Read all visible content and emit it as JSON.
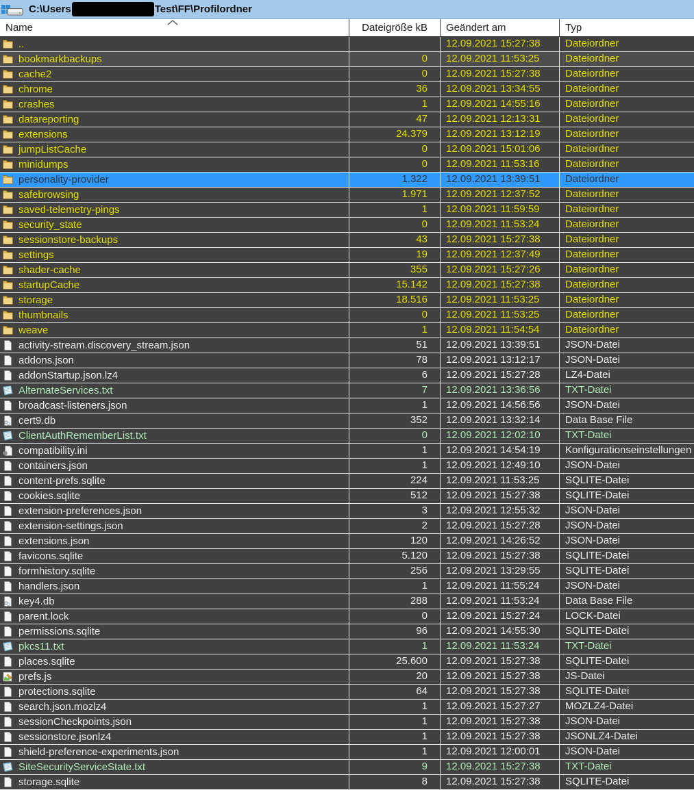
{
  "window": {
    "title_prefix": "C:\\Users",
    "title_suffix": "Test\\FF\\Profilordner",
    "username_redacted": true
  },
  "colors": {
    "titlebar_bg": "#A5C9E9",
    "row_bg": "#414141",
    "cursor_row_bg": "#4D4D4D",
    "selected_bg": "#2F99FC",
    "folder_text": "#E2DF00",
    "file_text": "#EDEDED",
    "txt_text": "#AFE9B6",
    "grid_line": "#E6E6E6"
  },
  "columns": [
    {
      "label": "Name",
      "sort": "ascending"
    },
    {
      "label": "Dateigröße kB",
      "sort": ""
    },
    {
      "label": "Geändert am",
      "sort": ""
    },
    {
      "label": "Typ",
      "sort": ""
    }
  ],
  "rows": [
    {
      "name": "..",
      "icon": "folder",
      "size": "",
      "modified": "12.09.2021 15:27:38",
      "type": "Dateiordner",
      "color": "folder",
      "state": ""
    },
    {
      "name": "bookmarkbackups",
      "icon": "folder",
      "size": "0",
      "modified": "12.09.2021 11:53:25",
      "type": "Dateiordner",
      "color": "folder",
      "state": "cursor"
    },
    {
      "name": "cache2",
      "icon": "folder",
      "size": "0",
      "modified": "12.09.2021 15:27:38",
      "type": "Dateiordner",
      "color": "folder",
      "state": ""
    },
    {
      "name": "chrome",
      "icon": "folder",
      "size": "36",
      "modified": "12.09.2021 13:34:55",
      "type": "Dateiordner",
      "color": "folder",
      "state": ""
    },
    {
      "name": "crashes",
      "icon": "folder",
      "size": "1",
      "modified": "12.09.2021 14:55:16",
      "type": "Dateiordner",
      "color": "folder",
      "state": ""
    },
    {
      "name": "datareporting",
      "icon": "folder",
      "size": "47",
      "modified": "12.09.2021 12:13:31",
      "type": "Dateiordner",
      "color": "folder",
      "state": ""
    },
    {
      "name": "extensions",
      "icon": "folder",
      "size": "24.379",
      "modified": "12.09.2021 13:12:19",
      "type": "Dateiordner",
      "color": "folder",
      "state": ""
    },
    {
      "name": "jumpListCache",
      "icon": "folder",
      "size": "0",
      "modified": "12.09.2021 15:01:06",
      "type": "Dateiordner",
      "color": "folder",
      "state": ""
    },
    {
      "name": "minidumps",
      "icon": "folder",
      "size": "0",
      "modified": "12.09.2021 11:53:16",
      "type": "Dateiordner",
      "color": "folder",
      "state": ""
    },
    {
      "name": "personality-provider",
      "icon": "folder",
      "size": "1.322",
      "modified": "12.09.2021 13:39:51",
      "type": "Dateiordner",
      "color": "folder",
      "state": "selected"
    },
    {
      "name": "safebrowsing",
      "icon": "folder",
      "size": "1.971",
      "modified": "12.09.2021 12:37:52",
      "type": "Dateiordner",
      "color": "folder",
      "state": ""
    },
    {
      "name": "saved-telemetry-pings",
      "icon": "folder",
      "size": "1",
      "modified": "12.09.2021 11:59:59",
      "type": "Dateiordner",
      "color": "folder",
      "state": ""
    },
    {
      "name": "security_state",
      "icon": "folder",
      "size": "0",
      "modified": "12.09.2021 11:53:24",
      "type": "Dateiordner",
      "color": "folder",
      "state": ""
    },
    {
      "name": "sessionstore-backups",
      "icon": "folder",
      "size": "43",
      "modified": "12.09.2021 15:27:38",
      "type": "Dateiordner",
      "color": "folder",
      "state": ""
    },
    {
      "name": "settings",
      "icon": "folder",
      "size": "19",
      "modified": "12.09.2021 12:37:49",
      "type": "Dateiordner",
      "color": "folder",
      "state": ""
    },
    {
      "name": "shader-cache",
      "icon": "folder",
      "size": "355",
      "modified": "12.09.2021 15:27:26",
      "type": "Dateiordner",
      "color": "folder",
      "state": ""
    },
    {
      "name": "startupCache",
      "icon": "folder",
      "size": "15.142",
      "modified": "12.09.2021 15:27:38",
      "type": "Dateiordner",
      "color": "folder",
      "state": ""
    },
    {
      "name": "storage",
      "icon": "folder",
      "size": "18.516",
      "modified": "12.09.2021 11:53:25",
      "type": "Dateiordner",
      "color": "folder",
      "state": ""
    },
    {
      "name": "thumbnails",
      "icon": "folder",
      "size": "0",
      "modified": "12.09.2021 11:53:25",
      "type": "Dateiordner",
      "color": "folder",
      "state": ""
    },
    {
      "name": "weave",
      "icon": "folder",
      "size": "1",
      "modified": "12.09.2021 11:54:54",
      "type": "Dateiordner",
      "color": "folder",
      "state": ""
    },
    {
      "name": "activity-stream.discovery_stream.json",
      "icon": "file",
      "size": "51",
      "modified": "12.09.2021 13:39:51",
      "type": "JSON-Datei",
      "color": "file",
      "state": ""
    },
    {
      "name": "addons.json",
      "icon": "file",
      "size": "78",
      "modified": "12.09.2021 13:12:17",
      "type": "JSON-Datei",
      "color": "file",
      "state": ""
    },
    {
      "name": "addonStartup.json.lz4",
      "icon": "file",
      "size": "6",
      "modified": "12.09.2021 15:27:28",
      "type": "LZ4-Datei",
      "color": "file",
      "state": ""
    },
    {
      "name": "AlternateServices.txt",
      "icon": "txt",
      "size": "7",
      "modified": "12.09.2021 13:36:56",
      "type": "TXT-Datei",
      "color": "txt",
      "state": ""
    },
    {
      "name": "broadcast-listeners.json",
      "icon": "file",
      "size": "1",
      "modified": "12.09.2021 14:56:56",
      "type": "JSON-Datei",
      "color": "file",
      "state": ""
    },
    {
      "name": "cert9.db",
      "icon": "db",
      "size": "352",
      "modified": "12.09.2021 13:32:14",
      "type": "Data Base File",
      "color": "file",
      "state": ""
    },
    {
      "name": "ClientAuthRememberList.txt",
      "icon": "txt",
      "size": "0",
      "modified": "12.09.2021 12:02:10",
      "type": "TXT-Datei",
      "color": "txt",
      "state": ""
    },
    {
      "name": "compatibility.ini",
      "icon": "ini",
      "size": "1",
      "modified": "12.09.2021 14:54:19",
      "type": "Konfigurationseinstellungen",
      "color": "file",
      "state": ""
    },
    {
      "name": "containers.json",
      "icon": "file",
      "size": "1",
      "modified": "12.09.2021 12:49:10",
      "type": "JSON-Datei",
      "color": "file",
      "state": ""
    },
    {
      "name": "content-prefs.sqlite",
      "icon": "file",
      "size": "224",
      "modified": "12.09.2021 11:53:25",
      "type": "SQLITE-Datei",
      "color": "file",
      "state": ""
    },
    {
      "name": "cookies.sqlite",
      "icon": "file",
      "size": "512",
      "modified": "12.09.2021 15:27:38",
      "type": "SQLITE-Datei",
      "color": "file",
      "state": ""
    },
    {
      "name": "extension-preferences.json",
      "icon": "file",
      "size": "3",
      "modified": "12.09.2021 12:55:32",
      "type": "JSON-Datei",
      "color": "file",
      "state": ""
    },
    {
      "name": "extension-settings.json",
      "icon": "file",
      "size": "2",
      "modified": "12.09.2021 15:27:28",
      "type": "JSON-Datei",
      "color": "file",
      "state": ""
    },
    {
      "name": "extensions.json",
      "icon": "file",
      "size": "120",
      "modified": "12.09.2021 14:26:52",
      "type": "JSON-Datei",
      "color": "file",
      "state": ""
    },
    {
      "name": "favicons.sqlite",
      "icon": "file",
      "size": "5.120",
      "modified": "12.09.2021 15:27:38",
      "type": "SQLITE-Datei",
      "color": "file",
      "state": ""
    },
    {
      "name": "formhistory.sqlite",
      "icon": "file",
      "size": "256",
      "modified": "12.09.2021 13:29:55",
      "type": "SQLITE-Datei",
      "color": "file",
      "state": ""
    },
    {
      "name": "handlers.json",
      "icon": "file",
      "size": "1",
      "modified": "12.09.2021 11:55:24",
      "type": "JSON-Datei",
      "color": "file",
      "state": ""
    },
    {
      "name": "key4.db",
      "icon": "db",
      "size": "288",
      "modified": "12.09.2021 11:53:24",
      "type": "Data Base File",
      "color": "file",
      "state": ""
    },
    {
      "name": "parent.lock",
      "icon": "file",
      "size": "0",
      "modified": "12.09.2021 15:27:24",
      "type": "LOCK-Datei",
      "color": "file",
      "state": ""
    },
    {
      "name": "permissions.sqlite",
      "icon": "file",
      "size": "96",
      "modified": "12.09.2021 14:55:30",
      "type": "SQLITE-Datei",
      "color": "file",
      "state": ""
    },
    {
      "name": "pkcs11.txt",
      "icon": "txt",
      "size": "1",
      "modified": "12.09.2021 11:53:24",
      "type": "TXT-Datei",
      "color": "txt",
      "state": ""
    },
    {
      "name": "places.sqlite",
      "icon": "file",
      "size": "25.600",
      "modified": "12.09.2021 15:27:38",
      "type": "SQLITE-Datei",
      "color": "file",
      "state": ""
    },
    {
      "name": "prefs.js",
      "icon": "js",
      "size": "20",
      "modified": "12.09.2021 15:27:38",
      "type": "JS-Datei",
      "color": "file",
      "state": ""
    },
    {
      "name": "protections.sqlite",
      "icon": "file",
      "size": "64",
      "modified": "12.09.2021 15:27:38",
      "type": "SQLITE-Datei",
      "color": "file",
      "state": ""
    },
    {
      "name": "search.json.mozlz4",
      "icon": "file",
      "size": "1",
      "modified": "12.09.2021 15:27:27",
      "type": "MOZLZ4-Datei",
      "color": "file",
      "state": ""
    },
    {
      "name": "sessionCheckpoints.json",
      "icon": "file",
      "size": "1",
      "modified": "12.09.2021 15:27:38",
      "type": "JSON-Datei",
      "color": "file",
      "state": ""
    },
    {
      "name": "sessionstore.jsonlz4",
      "icon": "file",
      "size": "1",
      "modified": "12.09.2021 15:27:38",
      "type": "JSONLZ4-Datei",
      "color": "file",
      "state": ""
    },
    {
      "name": "shield-preference-experiments.json",
      "icon": "file",
      "size": "1",
      "modified": "12.09.2021 12:00:01",
      "type": "JSON-Datei",
      "color": "file",
      "state": ""
    },
    {
      "name": "SiteSecurityServiceState.txt",
      "icon": "txt",
      "size": "9",
      "modified": "12.09.2021 15:27:38",
      "type": "TXT-Datei",
      "color": "txt",
      "state": ""
    },
    {
      "name": "storage.sqlite",
      "icon": "file",
      "size": "8",
      "modified": "12.09.2021 15:27:38",
      "type": "SQLITE-Datei",
      "color": "file",
      "state": ""
    }
  ]
}
